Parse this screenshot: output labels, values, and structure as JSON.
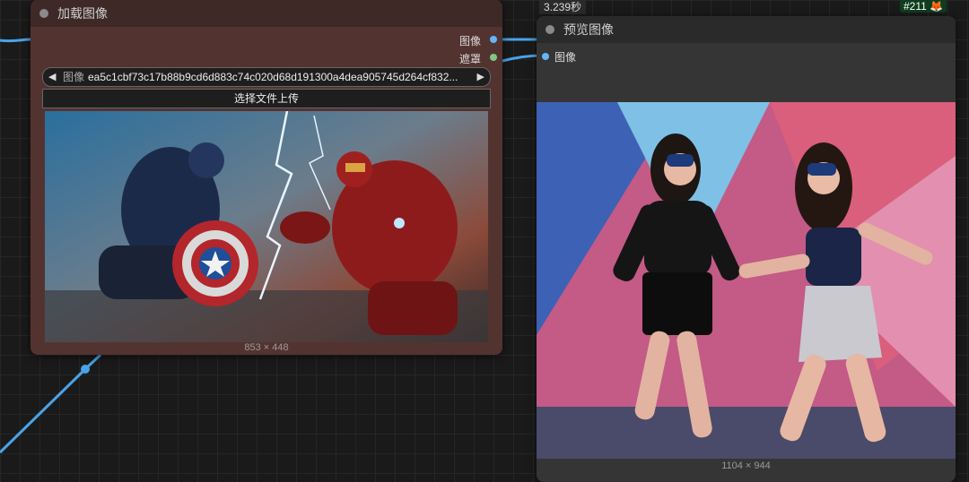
{
  "load_node": {
    "title": "加载图像",
    "outputs": [
      "图像",
      "遮罩"
    ],
    "combo": {
      "label": "图像",
      "value": "ea5c1cbf73c17b88b9cd6d883c74c020d68d191300a4dea905745d264cf832..."
    },
    "upload_button": "选择文件上传",
    "image_size": "853 × 448",
    "image_alt": "Captain America vs Iron Man battle art"
  },
  "preview_node": {
    "title": "预览图像",
    "input": "图像",
    "image_size": "1104 × 944",
    "image_alt": "Two women wearing Captain America masks on stage"
  },
  "execution_time": "3.239秒",
  "queue_badge": "#211 🦊",
  "colors": {
    "image_port": "#64b5f6",
    "mask_port": "#81c784",
    "wire": "#4aa3e8"
  }
}
